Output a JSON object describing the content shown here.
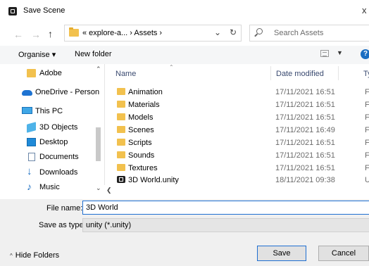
{
  "window": {
    "title": "Save Scene",
    "close": "x"
  },
  "address": {
    "path": "« explore-a... › Assets ›",
    "search_placeholder": "Search Assets"
  },
  "toolbar": {
    "organise": "Organise ▾",
    "new_folder": "New folder"
  },
  "nav": {
    "items": [
      {
        "label": "Adobe",
        "icon": "folder-icon"
      },
      {
        "label": "OneDrive - Person",
        "icon": "onedrive-icon"
      },
      {
        "label": "This PC",
        "icon": "pc-icon"
      },
      {
        "label": "3D Objects",
        "icon": "3d-objects-icon"
      },
      {
        "label": "Desktop",
        "icon": "desktop-icon"
      },
      {
        "label": "Documents",
        "icon": "documents-icon"
      },
      {
        "label": "Downloads",
        "icon": "downloads-icon"
      },
      {
        "label": "Music",
        "icon": "music-icon"
      }
    ]
  },
  "files": {
    "columns": [
      "Name",
      "Date modified",
      "Ty"
    ],
    "rows": [
      {
        "name": "Animation",
        "date": "17/11/2021 16:51",
        "type": "Fi",
        "icon": "folder-icon"
      },
      {
        "name": "Materials",
        "date": "17/11/2021 16:51",
        "type": "Fi",
        "icon": "folder-icon"
      },
      {
        "name": "Models",
        "date": "17/11/2021 16:51",
        "type": "Fi",
        "icon": "folder-icon"
      },
      {
        "name": "Scenes",
        "date": "17/11/2021 16:49",
        "type": "Fi",
        "icon": "folder-icon"
      },
      {
        "name": "Scripts",
        "date": "17/11/2021 16:51",
        "type": "Fi",
        "icon": "folder-icon"
      },
      {
        "name": "Sounds",
        "date": "17/11/2021 16:51",
        "type": "Fi",
        "icon": "folder-icon"
      },
      {
        "name": "Textures",
        "date": "17/11/2021 16:51",
        "type": "Fi",
        "icon": "folder-icon"
      },
      {
        "name": "3D World.unity",
        "date": "18/11/2021 09:38",
        "type": "U",
        "icon": "unity-file-icon"
      }
    ]
  },
  "form": {
    "file_name_label": "File name:",
    "file_name_value": "3D World",
    "save_type_label": "Save as type:",
    "save_type_value": "unity (*.unity)"
  },
  "footer": {
    "hide_folders": "Hide Folders",
    "save": "Save",
    "cancel": "Cancel"
  },
  "colors": {
    "accent": "#1f6fd1",
    "folder": "#f2c14e"
  }
}
